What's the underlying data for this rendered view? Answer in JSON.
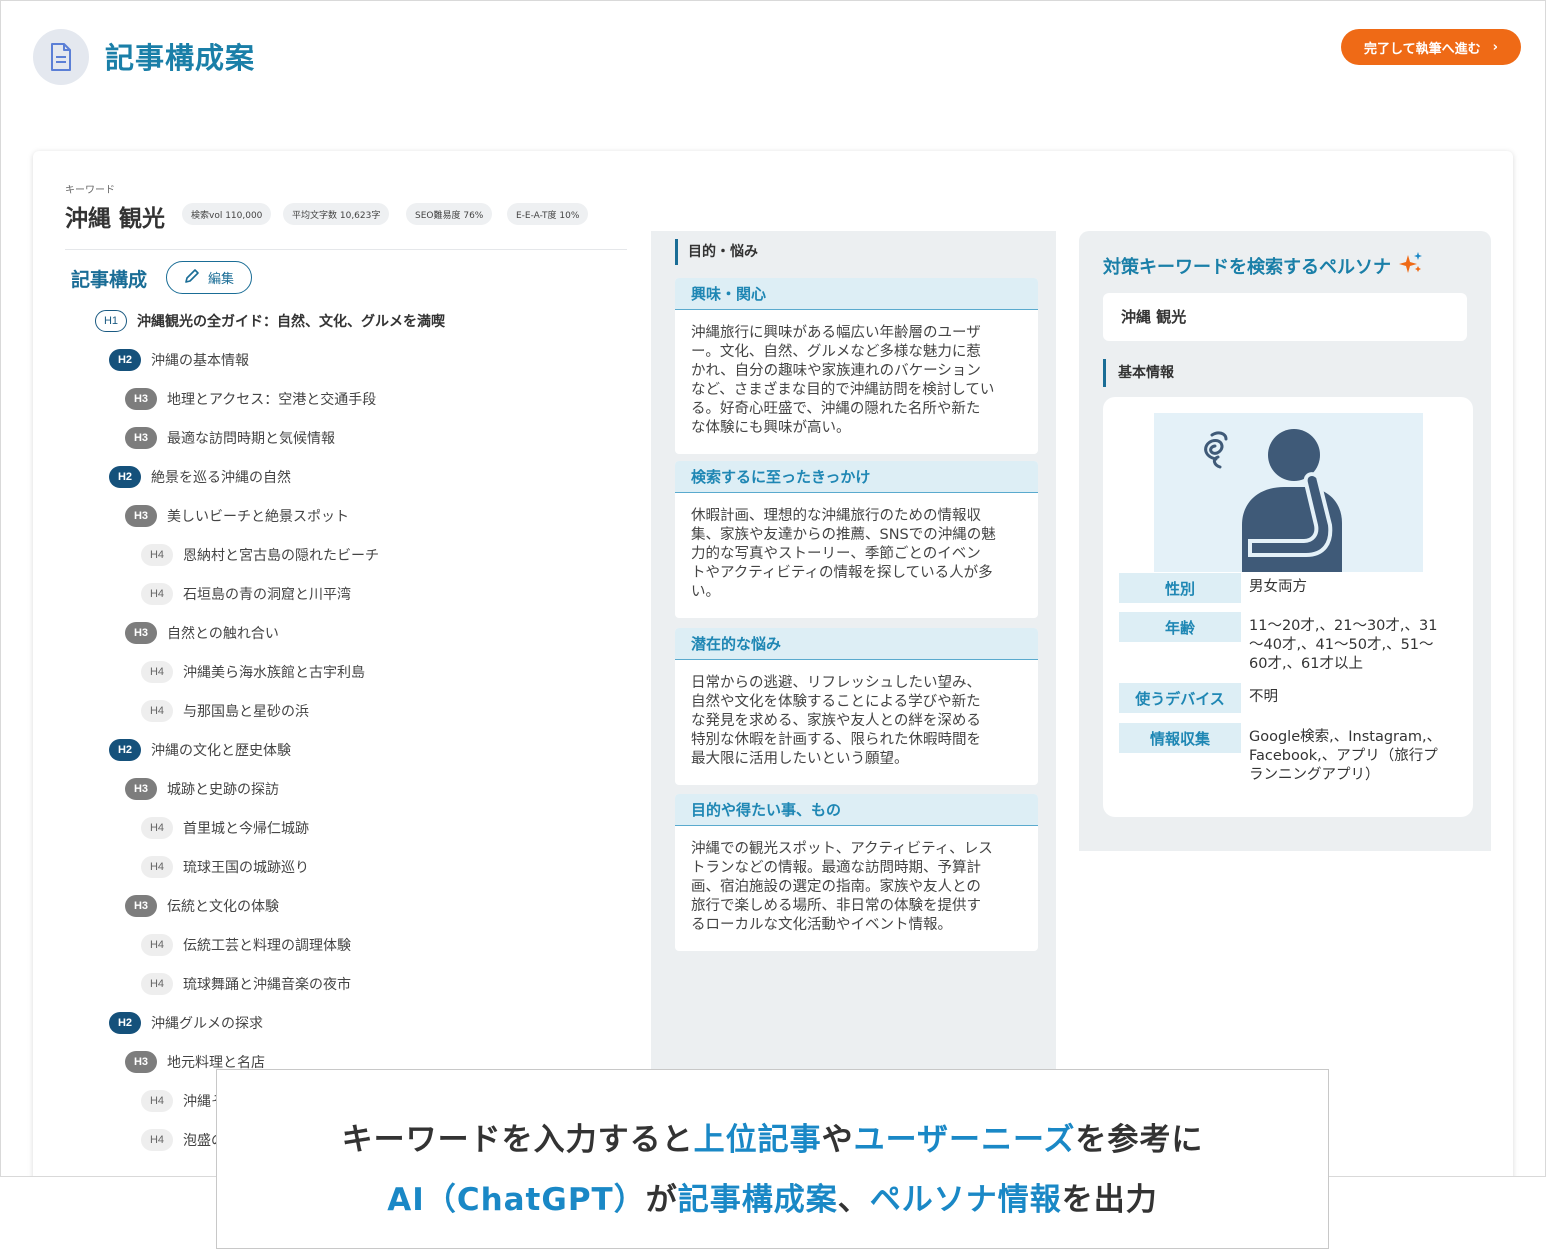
{
  "header": {
    "title": "記事構成案",
    "done_button": "完了して執筆へ進む",
    "icon": "document-icon"
  },
  "keyword": {
    "label": "キーワード",
    "value": "沖縄 観光",
    "badges": [
      "検索vol 110,000",
      "平均文字数 10,623字",
      "SEO難易度 76%",
      "E-E-A-T度 10%"
    ]
  },
  "outline": {
    "title": "記事構成",
    "edit_button": "編集",
    "items": [
      {
        "level": "H1",
        "text": "沖縄観光の全ガイド：自然、文化、グルメを満喫"
      },
      {
        "level": "H2",
        "text": "沖縄の基本情報"
      },
      {
        "level": "H3",
        "text": "地理とアクセス：空港と交通手段"
      },
      {
        "level": "H3",
        "text": "最適な訪問時期と気候情報"
      },
      {
        "level": "H2",
        "text": "絶景を巡る沖縄の自然"
      },
      {
        "level": "H3",
        "text": "美しいビーチと絶景スポット"
      },
      {
        "level": "H4",
        "text": "恩納村と宮古島の隠れたビーチ"
      },
      {
        "level": "H4",
        "text": "石垣島の青の洞窟と川平湾"
      },
      {
        "level": "H3",
        "text": "自然との触れ合い"
      },
      {
        "level": "H4",
        "text": "沖縄美ら海水族館と古宇利島"
      },
      {
        "level": "H4",
        "text": "与那国島と星砂の浜"
      },
      {
        "level": "H2",
        "text": "沖縄の文化と歴史体験"
      },
      {
        "level": "H3",
        "text": "城跡と史跡の探訪"
      },
      {
        "level": "H4",
        "text": "首里城と今帰仁城跡"
      },
      {
        "level": "H4",
        "text": "琉球王国の城跡巡り"
      },
      {
        "level": "H3",
        "text": "伝統と文化の体験"
      },
      {
        "level": "H4",
        "text": "伝統工芸と料理の調理体験"
      },
      {
        "level": "H4",
        "text": "琉球舞踊と沖縄音楽の夜市"
      },
      {
        "level": "H2",
        "text": "沖縄グルメの探求"
      },
      {
        "level": "H3",
        "text": "地元料理と名店"
      },
      {
        "level": "H4",
        "text": "沖縄そ"
      },
      {
        "level": "H4",
        "text": "泡盛の"
      }
    ]
  },
  "purpose": {
    "heading": "目的・悩み",
    "sections": [
      {
        "title": "興味・関心",
        "lines": [
          "沖縄旅行に興味がある幅広い年齢層のユーザ",
          "ー。文化、自然、グルメなど多様な魅力に惹",
          "かれ、自分の趣味や家族連れのバケーション",
          "など、さまざまな目的で沖縄訪問を検討してい",
          "る。好奇心旺盛で、沖縄の隠れた名所や新た",
          "な体験にも興味が高い。"
        ]
      },
      {
        "title": "検索するに至ったきっかけ",
        "lines": [
          "休暇計画、理想的な沖縄旅行のための情報収",
          "集、家族や友達からの推薦、SNSでの沖縄の魅",
          "力的な写真やストーリー、季節ごとのイベン",
          "トやアクティビティの情報を探している人が多",
          "い。"
        ]
      },
      {
        "title": "潜在的な悩み",
        "lines": [
          "日常からの逃避、リフレッシュしたい望み、",
          "自然や文化を体験することによる学びや新た",
          "な発見を求める、家族や友人との絆を深める",
          "特別な休暇を計画する、限られた休暇時間を",
          "最大限に活用したいという願望。"
        ]
      },
      {
        "title": "目的や得たい事、もの",
        "lines": [
          "沖縄での観光スポット、アクティビティ、レス",
          "トランなどの情報。最適な訪問時期、予算計",
          "画、宿泊施設の選定の指南。家族や友人との",
          "旅行で楽しめる場所、非日常の体験を提供す",
          "るローカルな文化活動やイベント情報。"
        ]
      }
    ]
  },
  "persona": {
    "title": "対策キーワードを検索するペルソナ",
    "keyword": "沖縄 観光",
    "basic_heading": "基本情報",
    "attributes": [
      {
        "label": "性別",
        "lines": [
          "男女両方"
        ]
      },
      {
        "label": "年齢",
        "lines": [
          "11〜20才,、21〜30才,、31",
          "〜40才,、41〜50才,、51〜",
          "60才,、61才以上"
        ]
      },
      {
        "label": "使うデバイス",
        "lines": [
          "不明"
        ]
      },
      {
        "label": "情報収集",
        "lines": [
          "Google検索,、Instagram,、",
          "Facebook,、アプリ（旅行プ",
          "ランニングアプリ）"
        ]
      }
    ]
  },
  "caption": {
    "line1": [
      {
        "text": "キーワードを入力すると",
        "hl": false
      },
      {
        "text": "上位記事",
        "hl": true
      },
      {
        "text": "や",
        "hl": false
      },
      {
        "text": "ユーザーニーズ",
        "hl": true
      },
      {
        "text": "を参考に",
        "hl": false
      }
    ],
    "line2": [
      {
        "text": "AI（ChatGPT）",
        "hl": true
      },
      {
        "text": "が",
        "hl": false
      },
      {
        "text": "記事構成案",
        "hl": true
      },
      {
        "text": "、",
        "hl": false
      },
      {
        "text": "ペルソナ情報",
        "hl": true
      },
      {
        "text": "を出力",
        "hl": false
      }
    ]
  },
  "colors": {
    "accent": "#1a7fa8",
    "button": "#ef6a16",
    "h2_tag": "#15517b",
    "h3_tag": "#7d7d7d"
  }
}
